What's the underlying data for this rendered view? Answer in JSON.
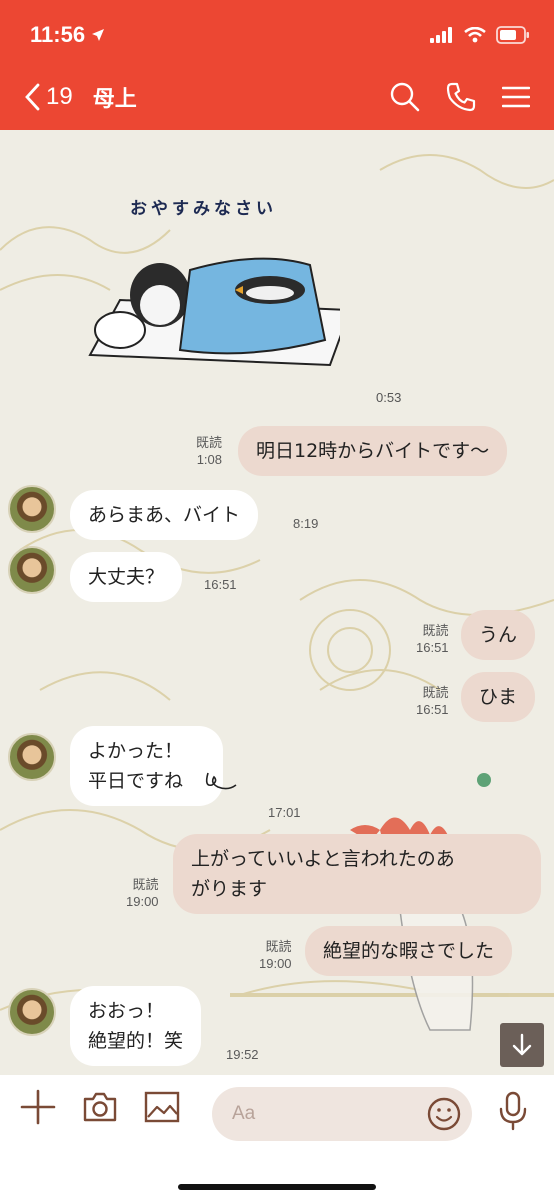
{
  "status_bar": {
    "time": "11:56"
  },
  "header": {
    "back_count": "19",
    "title": "母上"
  },
  "chat": {
    "sticker_text": "おやすみなさい",
    "sticker_time": "0:53",
    "messages": [
      {
        "dir": "out",
        "lines": [
          "明日12時からバイトです〜"
        ],
        "read": "既読",
        "time": "1:08"
      },
      {
        "dir": "in",
        "lines": [
          "あらまあ、バイト"
        ],
        "time": "8:19"
      },
      {
        "dir": "in",
        "lines": [
          "大丈夫？"
        ],
        "time": "16:51"
      },
      {
        "dir": "out",
        "lines": [
          "うん"
        ],
        "read": "既読",
        "time": "16:51"
      },
      {
        "dir": "out",
        "lines": [
          "ひま"
        ],
        "read": "既読",
        "time": "16:51"
      },
      {
        "dir": "in",
        "lines": [
          "よかった！",
          "平日ですね"
        ],
        "time": "17:01"
      },
      {
        "dir": "out",
        "lines": [
          "上がっていいよと言われたのあ",
          "がります"
        ],
        "read": "既読",
        "time": "19:00"
      },
      {
        "dir": "out",
        "lines": [
          "絶望的な暇さでした"
        ],
        "read": "既読",
        "time": "19:00"
      },
      {
        "dir": "in",
        "lines": [
          "おおっ！",
          "絶望的！笑"
        ],
        "time": "19:52"
      }
    ]
  },
  "input": {
    "placeholder": "Aa"
  },
  "icons": [
    "location-arrow-icon",
    "signal-icon",
    "wifi-icon",
    "battery-icon",
    "back-chevron-icon",
    "search-icon",
    "phone-icon",
    "menu-icon",
    "plus-icon",
    "camera-icon",
    "image-icon",
    "emoji-icon",
    "mic-icon",
    "arrow-down-icon"
  ],
  "colors": {
    "header": "#ec4733",
    "outgoing_bubble": "#ecd9cf",
    "incoming_bubble": "#ffffff",
    "input_bg": "#efe5df",
    "icon_brown": "#7a4a36"
  }
}
